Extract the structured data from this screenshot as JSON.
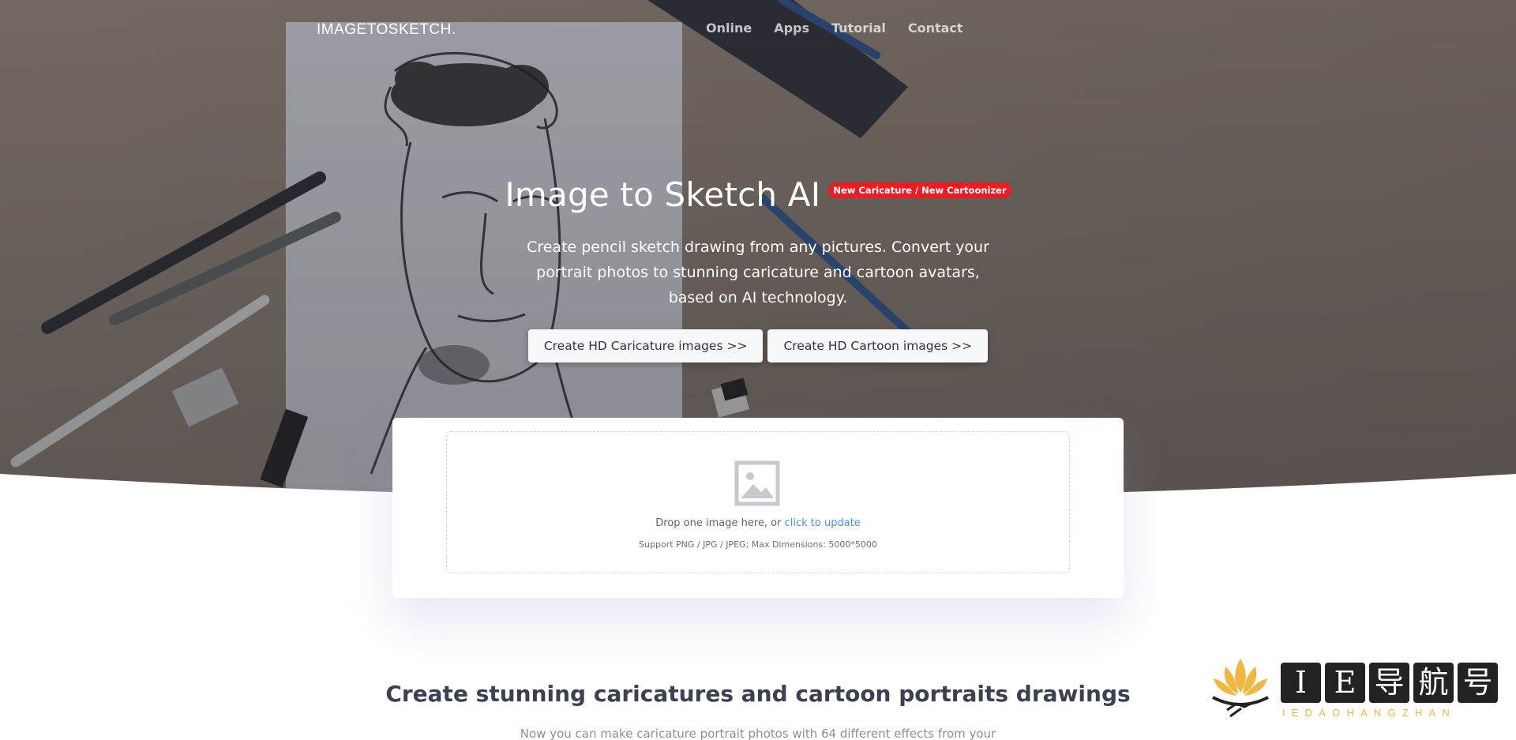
{
  "brand": "IMAGETOSKETCH.",
  "nav": [
    {
      "label": "Online"
    },
    {
      "label": "Apps"
    },
    {
      "label": "Tutorial"
    },
    {
      "label": "Contact"
    }
  ],
  "hero": {
    "title": "Image to Sketch AI",
    "badge": "New Caricature / New Cartoonizer",
    "description": "Create pencil sketch drawing from any pictures. Convert your portrait photos to stunning caricature and cartoon avatars, based on AI technology.",
    "buttons": [
      {
        "label": "Create HD Caricature images >>"
      },
      {
        "label": "Create HD Cartoon images >>"
      }
    ]
  },
  "upload": {
    "icon": "image-icon",
    "drop_text": "Drop one image here, or ",
    "link_text": "click to update",
    "support_text": "Support PNG / JPG / JPEG; Max Dimensions: 5000*5000"
  },
  "section": {
    "title": "Create stunning caricatures and cartoon portraits drawings",
    "subtitle": "Now you can make caricature portrait photos with 64 different effects from your"
  },
  "watermark": {
    "chars": [
      "I",
      "E",
      "导",
      "航",
      "号"
    ],
    "sub": "IEDAOHANGZHAN"
  },
  "colors": {
    "badge": "#ea1c24",
    "link": "#4a8fe7",
    "watermark_accent": "#f0b842"
  }
}
